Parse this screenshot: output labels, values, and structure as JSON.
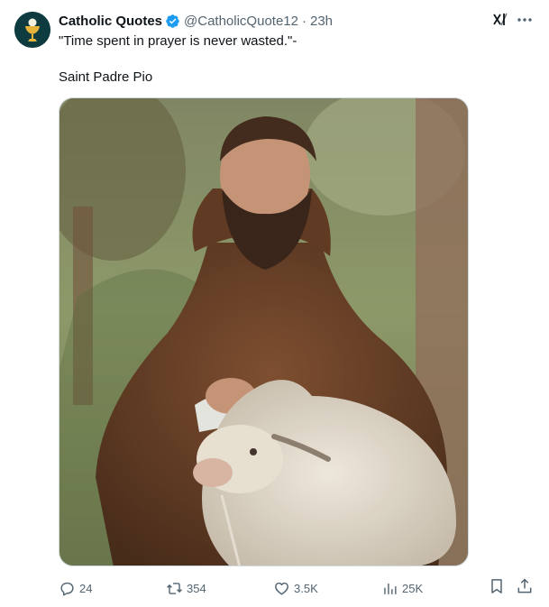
{
  "tweet": {
    "display_name": "Catholic Quotes",
    "handle": "@CatholicQuote12",
    "separator": "·",
    "time": "23h",
    "verified_color": "#1d9bf0",
    "text_line1": "\"Time spent in prayer is never wasted.\"-",
    "text_line2": "Saint Padre Pio",
    "avatar_icon": "chalice-host-icon",
    "media_description_icon": "photo"
  },
  "actions": {
    "replies": "24",
    "reposts": "354",
    "likes": "3.5K",
    "views": "25K"
  },
  "icons": {
    "reply": "speech-bubble-icon",
    "repost": "repost-arrows-icon",
    "like": "heart-icon",
    "views": "bar-chart-icon",
    "bookmark": "bookmark-icon",
    "share": "share-upload-icon",
    "grok": "grok-icon",
    "more": "more-dots-icon"
  },
  "colors": {
    "text_primary": "#0f1419",
    "text_secondary": "#536471",
    "avatar_bg": "#0e3b40",
    "chalice": "#e6b33b"
  }
}
